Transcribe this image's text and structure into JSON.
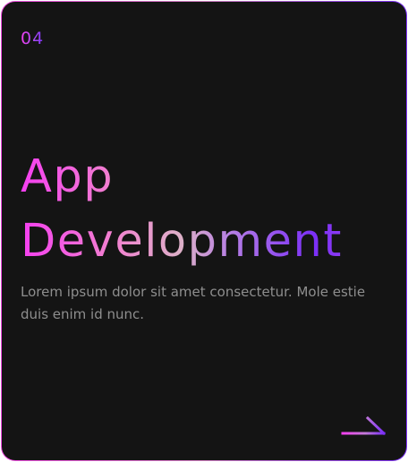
{
  "card": {
    "number": "04",
    "title_line1": "App",
    "title_line2": "Development",
    "description": "Lorem ipsum dolor sit amet consectetur. Mole estie duis enim id nunc.",
    "arrow_icon": "arrow-right-icon",
    "colors": {
      "background": "#141414",
      "gradient_start": "#f43ff0",
      "gradient_mid": "#ddb0c8",
      "gradient_end": "#7b2ff7",
      "description_text": "#8e8e8e"
    }
  }
}
